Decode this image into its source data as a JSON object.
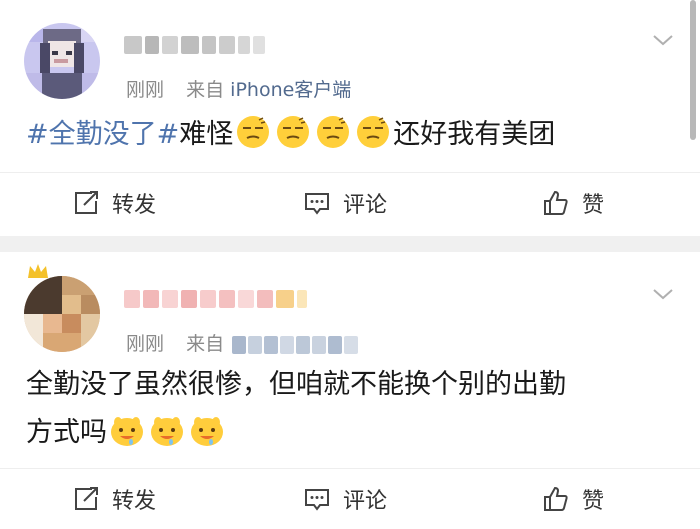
{
  "post1": {
    "username": "",
    "time": "刚刚",
    "source_prefix": "来自",
    "source_name": "iPhone客户端",
    "content_topic": "#全勤没了#",
    "content_mid": "难怪",
    "content_end": "还好我有美团",
    "actions": {
      "repost": "转发",
      "comment": "评论",
      "like": "赞"
    }
  },
  "post2": {
    "username": "",
    "time": "刚刚",
    "source_prefix": "来自",
    "content_line1": "全勤没了虽然很惨，但咱就不能换个别的出勤",
    "content_line2": "方式吗",
    "actions": {
      "repost": "转发",
      "comment": "评论",
      "like": "赞"
    }
  },
  "colors": {
    "topic": "#4f74ad",
    "source": "#526a8e",
    "meta": "#8a8a8a",
    "separator": "#f0f0f0"
  },
  "icons": [
    "repost-icon",
    "comment-icon",
    "like-icon",
    "chevron-down-icon",
    "smirk-emoji",
    "drooling-emoji"
  ]
}
